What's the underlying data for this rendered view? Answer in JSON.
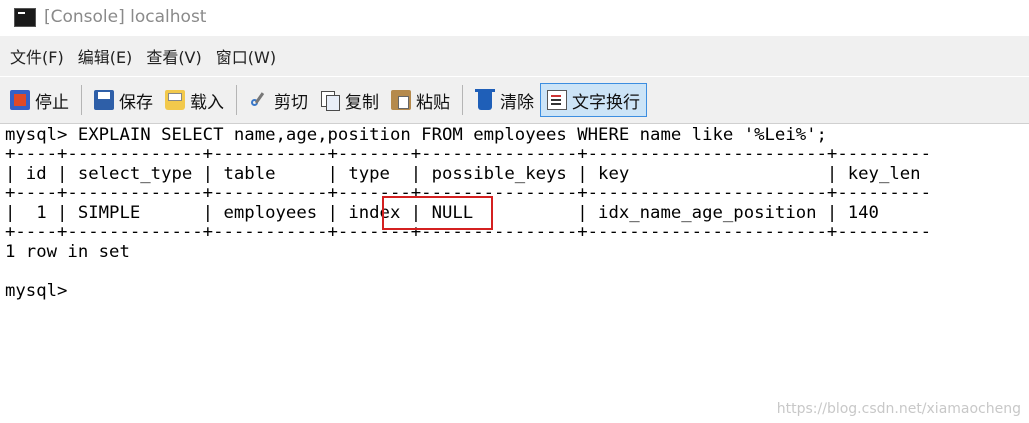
{
  "window": {
    "title": "[Console] localhost",
    "icon": "console-icon"
  },
  "menu": {
    "items": [
      "文件(F)",
      "编辑(E)",
      "查看(V)",
      "窗口(W)"
    ]
  },
  "toolbar": {
    "stop_label": "停止",
    "save_label": "保存",
    "load_label": "载入",
    "cut_label": "剪切",
    "copy_label": "复制",
    "paste_label": "粘贴",
    "clear_label": "清除",
    "wrap_label": "文字换行",
    "wrap_active": true
  },
  "console": {
    "command": "mysql> EXPLAIN SELECT name,age,position FROM employees WHERE name like '%Lei%';",
    "border_top": "+----+-------------+-----------+-------+---------------+-----------------------+---------",
    "header_row": "| id | select_type | table     | type  | possible_keys | key                   | key_len",
    "border_mid": "+----+-------------+-----------+-------+---------------+-----------------------+---------",
    "data_row": "|  1 | SIMPLE      | employees | index | NULL          | idx_name_age_position | 140",
    "border_bottom": "+----+-------------+-----------+-------+---------------+-----------------------+---------",
    "summary": "1 row in set",
    "prompt": "mysql>",
    "highlight_color": "#d42020"
  },
  "watermark": "https://blog.csdn.net/xiamaocheng"
}
